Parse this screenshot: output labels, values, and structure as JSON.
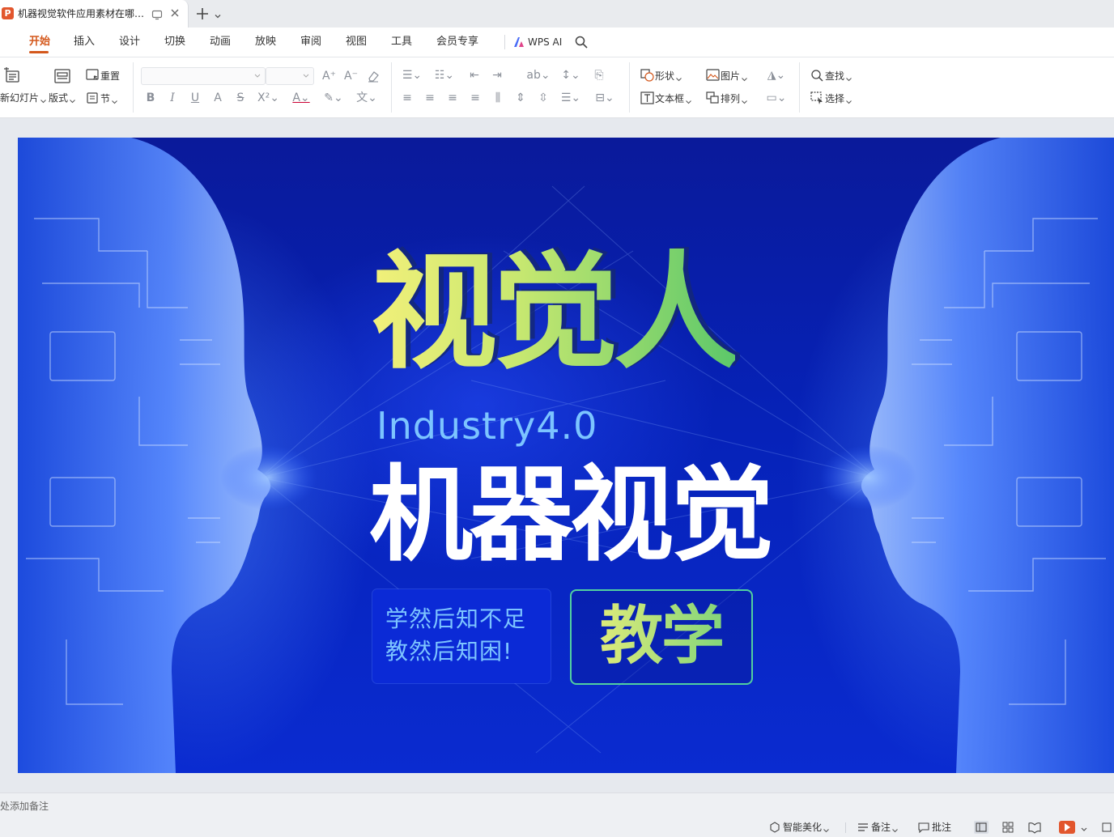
{
  "app": {
    "tab_title": "机器视觉软件应用素材在哪里...",
    "app_icon_letter": "P"
  },
  "ribbon": {
    "tabs": [
      "开始",
      "插入",
      "设计",
      "切换",
      "动画",
      "放映",
      "审阅",
      "视图",
      "工具",
      "会员专享"
    ],
    "active_tab": "开始",
    "wps_ai_label": "WPS AI"
  },
  "toolbar": {
    "new_slide_label": "新幻灯片",
    "layout_label": "版式",
    "reset_label": "重置",
    "section_label": "节",
    "shape_label": "形状",
    "picture_label": "图片",
    "textbox_label": "文本框",
    "arrange_label": "排列",
    "find_label": "查找",
    "select_label": "选择",
    "font_name": "",
    "font_size": ""
  },
  "slide": {
    "title_gradient": "视觉人",
    "subtitle": "Industry4.0",
    "main_title": "机器视觉",
    "quote_line1": "学然后知不足",
    "quote_line2": "教然后知困!",
    "badge_text": "教学"
  },
  "notes": {
    "placeholder": "单击此处添加备注"
  },
  "status": {
    "beautify_label": "智能美化",
    "notes_label": "备注",
    "comment_label": "批注"
  },
  "colors": {
    "accent": "#d4581c",
    "slide_bg": "#0622b8",
    "title_gradient_start": "#f2f07a",
    "title_gradient_end": "#5cc86a",
    "subtitle_color": "#7cc4ff",
    "badge_border": "#52d0a0"
  },
  "icons": {
    "app": "wps-presentation-icon",
    "tab_close": "close-icon",
    "new_tab": "plus-icon",
    "search": "search-icon",
    "wps_ai": "wps-ai-icon"
  }
}
